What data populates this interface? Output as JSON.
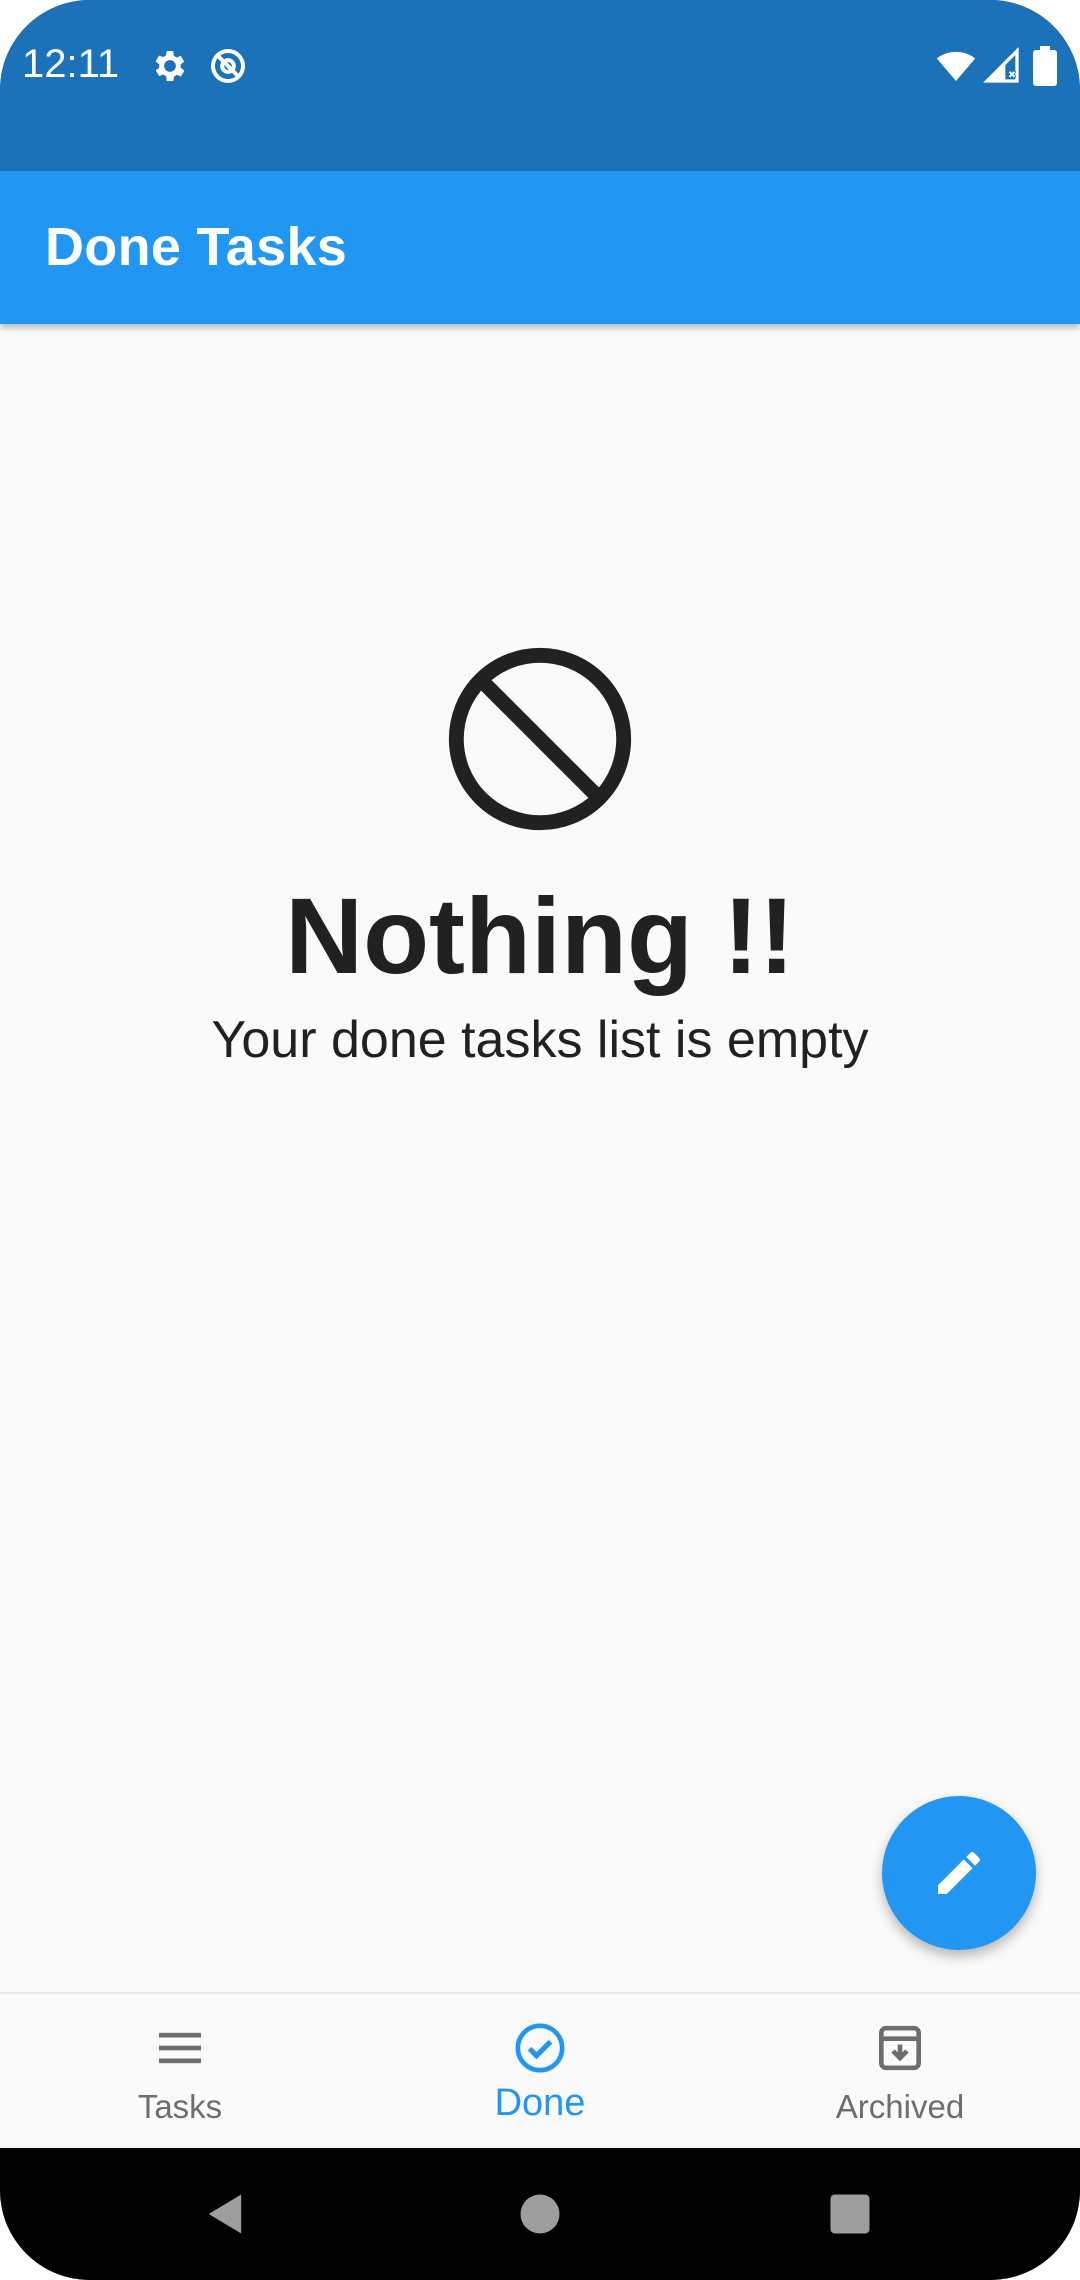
{
  "status_bar": {
    "time": "12:11",
    "icons": [
      "gear-icon",
      "at-sign-icon",
      "wifi-icon",
      "signal-icon",
      "battery-icon"
    ],
    "background_color": "#1b72b8"
  },
  "app_bar": {
    "title": "Done Tasks",
    "background_color": "#2196f3"
  },
  "empty_state": {
    "icon": "block-icon",
    "title": "Nothing !!",
    "subtitle": "Your done tasks list is empty"
  },
  "fab": {
    "icon": "pencil-icon",
    "color": "#2196f3"
  },
  "bottom_nav": {
    "items": [
      {
        "label": "Tasks",
        "icon": "menu-icon",
        "active": false
      },
      {
        "label": "Done",
        "icon": "check-circle-icon",
        "active": true
      },
      {
        "label": "Archived",
        "icon": "archive-icon",
        "active": false
      }
    ],
    "active_color": "#2196f3",
    "inactive_color": "#6e6e6e"
  },
  "system_nav": {
    "buttons": [
      "back-icon",
      "home-icon",
      "recents-icon"
    ]
  }
}
